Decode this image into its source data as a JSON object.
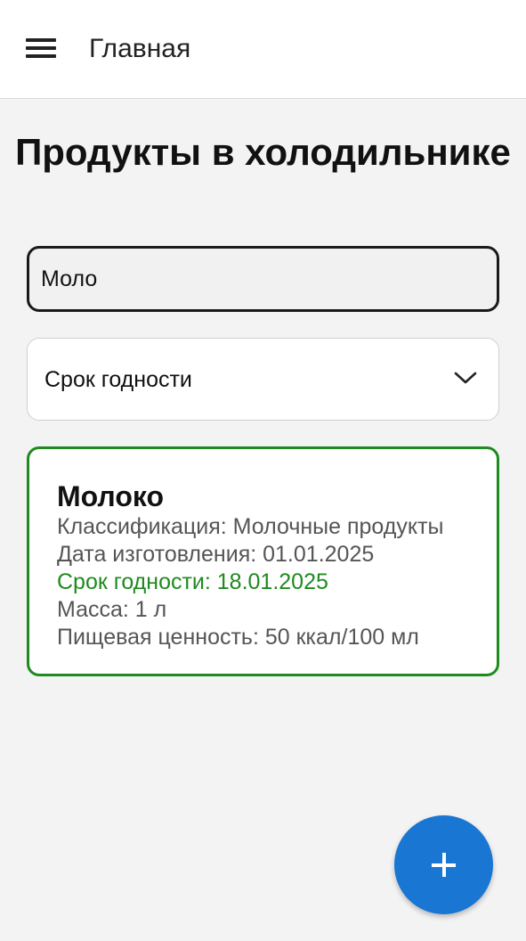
{
  "topbar": {
    "title": "Главная",
    "menu_icon": "hamburger-menu-icon"
  },
  "page": {
    "title": "Продукты в холодильнике"
  },
  "search": {
    "value": "Моло",
    "placeholder": ""
  },
  "sort": {
    "selected": "Срок годности",
    "icon": "chevron-down-icon"
  },
  "products": [
    {
      "name": "Молоко",
      "classification": "Классификация: Молочные продукты",
      "manufacture_date": "Дата изготовления: 01.01.2025",
      "expiry_date": "Срок годности: 18.01.2025",
      "mass": "Масса: 1 л",
      "nutrition": "Пищевая ценность: 50 ккал/100 мл",
      "status_color": "#1f8a1f"
    }
  ],
  "fab": {
    "icon": "plus-icon"
  },
  "colors": {
    "accent": "#1976d2",
    "fresh": "#1f8a1f",
    "background": "#f3f3f3"
  }
}
